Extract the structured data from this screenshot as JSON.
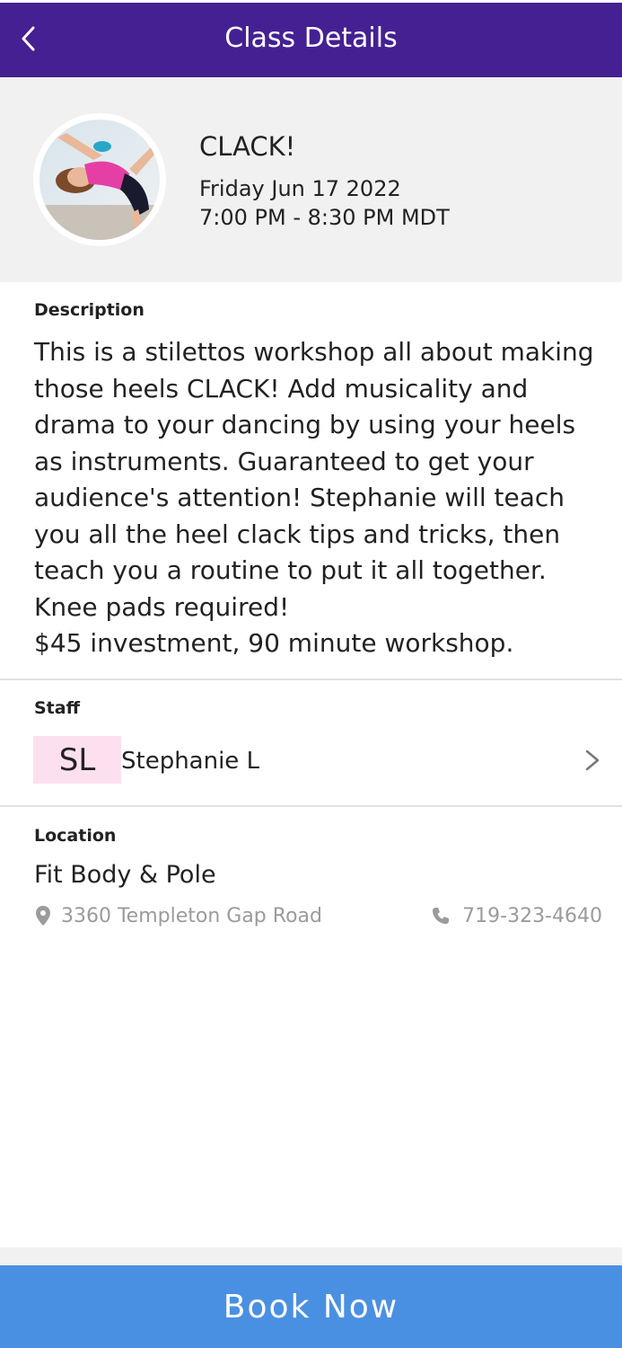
{
  "header": {
    "title": "Class Details",
    "back_icon": "chevron-left-icon"
  },
  "class_info": {
    "name": "CLACK!",
    "date": "Friday Jun 17 2022",
    "time": "7:00 PM - 8:30 PM MDT",
    "image": "dancer-photo"
  },
  "description": {
    "label": "Description",
    "text": "This is a stilettos workshop all about making those heels CLACK! Add musicality and drama to your dancing by using your heels as instruments. Guaranteed to get your audience's attention! Stephanie will teach you all the heel clack tips and tricks, then teach you a routine to put it all together. Knee pads required!\n$45 investment, 90 minute workshop."
  },
  "staff": {
    "label": "Staff",
    "initials": "SL",
    "name": "Stephanie L",
    "chevron_icon": "chevron-right-icon"
  },
  "location": {
    "label": "Location",
    "name": "Fit Body & Pole",
    "address": "3360 Templeton Gap Road",
    "phone": "719-323-4640",
    "pin_icon": "map-pin-icon",
    "phone_icon": "phone-icon"
  },
  "actions": {
    "book_label": "Book Now"
  },
  "colors": {
    "header_bg": "#452093",
    "button_bg": "#4a90e2",
    "initials_bg": "#fde0ef",
    "section_bg": "#f1f1f1"
  }
}
